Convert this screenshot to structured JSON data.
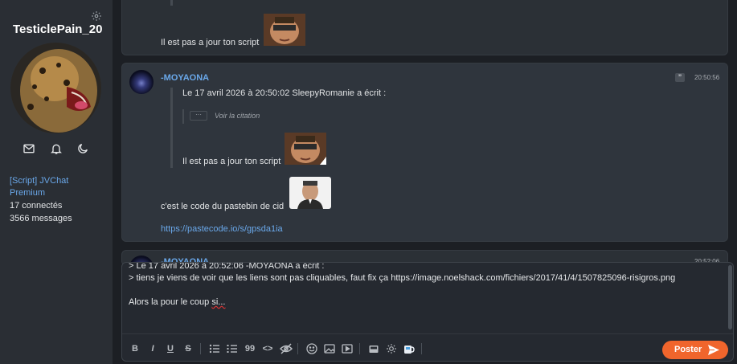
{
  "sidebar": {
    "username": "TesticlePain_20",
    "icons": [
      "gear-icon",
      "mail-icon",
      "bell-icon",
      "moon-icon"
    ],
    "script_link": "[Script] JVChat Premium",
    "connected": "17 connectés",
    "messages": "3566 messages"
  },
  "top_message": {
    "text": "Il est pas a jour ton script"
  },
  "main_message": {
    "author": "-MOYAONA",
    "time": "20:50:56",
    "quote_header": "Le 17 avril 2026 à 20:50:02 SleepyRomanie a écrit :",
    "view_quote_dots": "···",
    "view_quote": "Voir la citation",
    "quote_text": "Il est pas a jour ton script",
    "body_text": "c'est le code du pastebin de cid",
    "link": "https://pastecode.io/s/gpsda1ia"
  },
  "next_message": {
    "author": "-MOYAONA",
    "time": "20:52:06"
  },
  "editor": {
    "line1": "> Le 17 avril 2026 à 20:52:06 -MOYAONA a écrit :",
    "line2": "> tiens je viens de voir que les liens sont pas cliquables, faut fix ça https://image.noelshack.com/fichiers/2017/41/4/1507825096-risigros.png",
    "line3": "",
    "line4_a": "Alors la pour le coup ",
    "line4_b": "si...",
    "post_label": "Poster"
  },
  "toolbar": {
    "bold": "B",
    "italic": "I",
    "underline": "U",
    "strike": "S",
    "quote": "99",
    "code": "<>"
  },
  "colors": {
    "accent": "#f0652c",
    "link": "#6aa8ea",
    "background": "#1c1f24",
    "card": "#2f353d"
  }
}
